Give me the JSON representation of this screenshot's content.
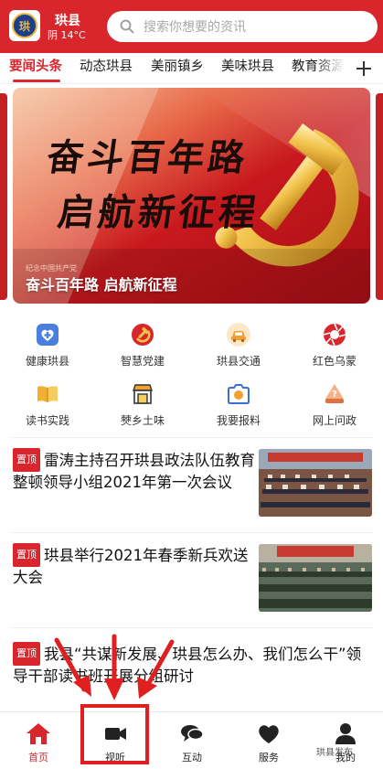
{
  "header": {
    "city": "珙县",
    "weather": "阴 14°C",
    "search_placeholder": "搜索你想要的资讯"
  },
  "tabs": [
    {
      "label": "要闻头条",
      "active": true
    },
    {
      "label": "动态珙县",
      "active": false
    },
    {
      "label": "美丽镇乡",
      "active": false
    },
    {
      "label": "美味珙县",
      "active": false
    },
    {
      "label": "教育资源",
      "active": false
    }
  ],
  "banner": {
    "art_line1": "奋斗百年路",
    "art_line2": "启航新征程",
    "small_text": "纪念中国共产党",
    "caption": "奋斗百年路 启航新征程"
  },
  "services": [
    {
      "label": "健康珙县",
      "icon": "health-icon",
      "color": "#4a7fe0"
    },
    {
      "label": "智慧党建",
      "icon": "party-emblem-icon",
      "color": "#d8262c"
    },
    {
      "label": "珙县交通",
      "icon": "car-icon",
      "color": "#f0a030"
    },
    {
      "label": "红色乌蒙",
      "icon": "aperture-icon",
      "color": "#d8262c"
    },
    {
      "label": "读书实践",
      "icon": "book-icon",
      "color": "#f0b030"
    },
    {
      "label": "僰乡土味",
      "icon": "shop-icon",
      "color": "#333333"
    },
    {
      "label": "我要报料",
      "icon": "camera-icon",
      "color": "#f0a030"
    },
    {
      "label": "网上问政",
      "icon": "question-icon",
      "color": "#e07040"
    }
  ],
  "news": [
    {
      "pin": "置顶",
      "title": "雷涛主持召开珙县政法队伍教育整顿领导小组2021年第一次会议"
    },
    {
      "pin": "置顶",
      "title": "珙县举行2021年春季新兵欢送大会"
    },
    {
      "pin": "置顶",
      "title": "我县“共谋新发展、珙县怎么办、我们怎么干”领导干部读书班开展分组研讨"
    }
  ],
  "bottom_nav": [
    {
      "label": "首页",
      "icon": "home-icon",
      "active": true
    },
    {
      "label": "视听",
      "icon": "video-icon",
      "active": false
    },
    {
      "label": "互动",
      "icon": "chat-icon",
      "active": false
    },
    {
      "label": "服务",
      "icon": "heart-icon",
      "active": false
    },
    {
      "label": "我的",
      "icon": "user-icon",
      "active": false
    }
  ],
  "watermark": "珙县发布",
  "colors": {
    "brand_red": "#d8262c",
    "annotation_red": "#e02020"
  }
}
